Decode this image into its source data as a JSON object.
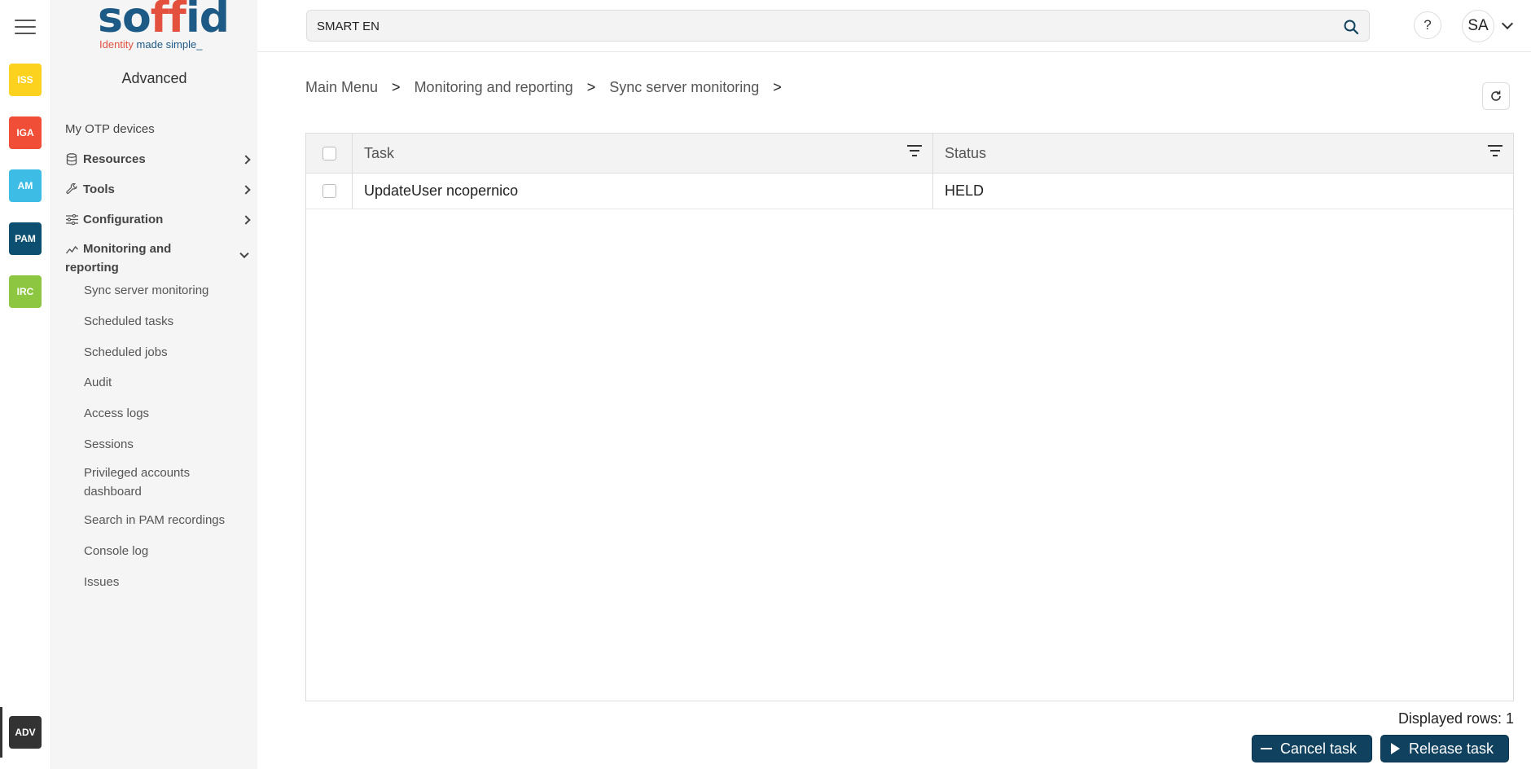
{
  "rail": {
    "apps": [
      {
        "label": "ISS",
        "color": "#fdd21e"
      },
      {
        "label": "IGA",
        "color": "#f04e37"
      },
      {
        "label": "AM",
        "color": "#3dbde5"
      },
      {
        "label": "PAM",
        "color": "#0d4f70"
      },
      {
        "label": "IRC",
        "color": "#8dc641"
      }
    ],
    "adv": {
      "label": "ADV",
      "color": "#333333"
    }
  },
  "sidebar": {
    "logo": {
      "word_a": "so",
      "word_b": "ff",
      "word_c": "id",
      "tag_a": "Identity",
      "tag_b": " made simple_"
    },
    "title": "Advanced",
    "items": [
      {
        "label": "My OTP devices",
        "icon": ""
      },
      {
        "label": "Resources",
        "icon": "database-icon"
      },
      {
        "label": "Tools",
        "icon": "wrench-icon"
      },
      {
        "label": "Configuration",
        "icon": "sliders-icon"
      },
      {
        "label": "Monitoring and reporting",
        "icon": "chart-line-icon"
      }
    ],
    "subitems": [
      "Sync server monitoring",
      "Scheduled tasks",
      "Scheduled jobs",
      "Audit",
      "Access logs",
      "Sessions",
      "Privileged accounts dashboard",
      "Search in PAM recordings",
      "Console log",
      "Issues"
    ]
  },
  "topbar": {
    "search_value": "SMART EN",
    "help": "?",
    "user_initials": "SA"
  },
  "breadcrumb": [
    "Main Menu",
    "Monitoring and reporting",
    "Sync server monitoring"
  ],
  "breadcrumb_sep": ">",
  "table": {
    "headers": {
      "task": "Task",
      "status": "Status"
    },
    "rows": [
      {
        "task": "UpdateUser ncopernico",
        "status": "HELD"
      }
    ]
  },
  "footer": {
    "displayed_rows": "Displayed rows: 1",
    "cancel_label": "Cancel task",
    "release_label": "Release task"
  }
}
